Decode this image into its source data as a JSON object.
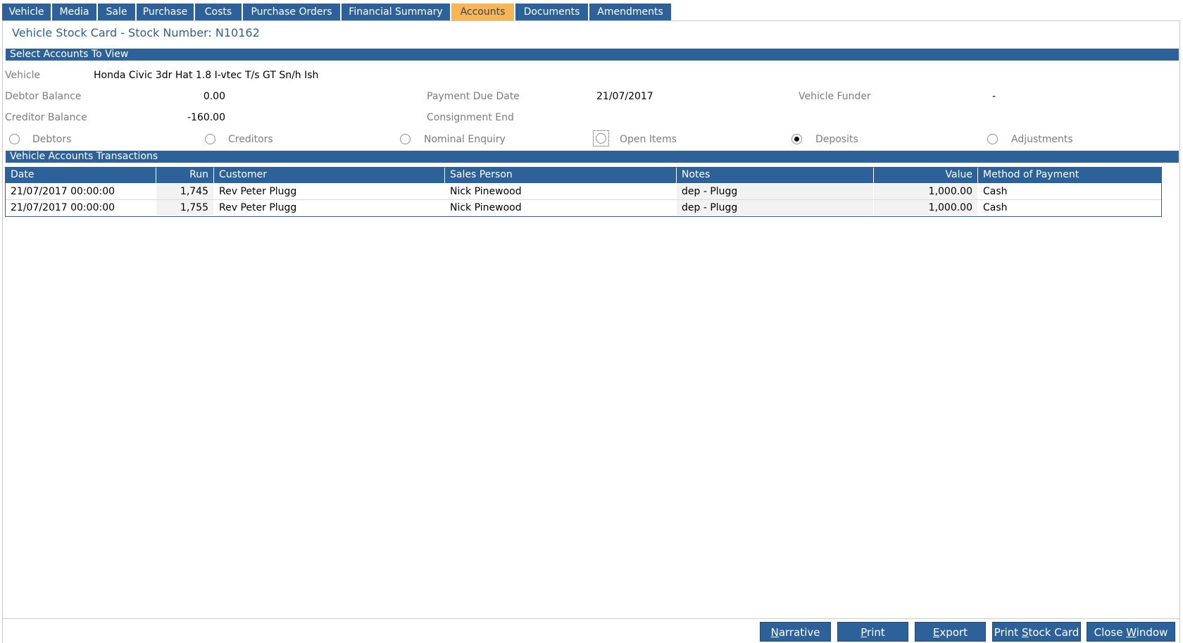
{
  "tabs": [
    {
      "label": "Vehicle"
    },
    {
      "label": "Media"
    },
    {
      "label": "Sale"
    },
    {
      "label": "Purchase"
    },
    {
      "label": "Costs"
    },
    {
      "label": "Purchase Orders"
    },
    {
      "label": "Financial Summary"
    },
    {
      "label": "Accounts"
    },
    {
      "label": "Documents"
    },
    {
      "label": "Amendments"
    }
  ],
  "active_tab": "Accounts",
  "page_title": "Vehicle Stock Card - Stock Number: N10162",
  "select_section_title": "Select Accounts To View",
  "vehicle": {
    "label": "Vehicle",
    "value": "Honda Civic 3dr Hat 1.8 I-vtec T/s GT Sn/h Ish"
  },
  "debtor_balance": {
    "label": "Debtor Balance",
    "value": "0.00"
  },
  "creditor_balance": {
    "label": "Creditor Balance",
    "value": "-160.00"
  },
  "payment_due_date": {
    "label": "Payment Due Date",
    "value": "21/07/2017"
  },
  "consignment_end": {
    "label": "Consignment End",
    "value": ""
  },
  "vehicle_funder": {
    "label": "Vehicle Funder",
    "value": "-"
  },
  "account_types": [
    {
      "label": "Debtors",
      "selected": false
    },
    {
      "label": "Creditors",
      "selected": false
    },
    {
      "label": "Nominal Enquiry",
      "selected": false
    },
    {
      "label": "Open Items",
      "selected": false
    },
    {
      "label": "Deposits",
      "selected": true
    },
    {
      "label": "Adjustments",
      "selected": false
    }
  ],
  "transactions_section_title": "Vehicle Accounts Transactions",
  "table": {
    "columns": [
      "Date",
      "Run",
      "Customer",
      "Sales Person",
      "Notes",
      "Value",
      "Method of Payment"
    ],
    "rows": [
      [
        "21/07/2017 00:00:00",
        "1,745",
        "Rev Peter Plugg",
        "Nick Pinewood",
        "dep - Plugg",
        "1,000.00",
        "Cash"
      ],
      [
        "21/07/2017 00:00:00",
        "1,755",
        "Rev Peter Plugg",
        "Nick Pinewood",
        "dep - Plugg",
        "1,000.00",
        "Cash"
      ]
    ]
  },
  "buttons": {
    "narrative": {
      "first": "N",
      "rest": "arrative"
    },
    "print": {
      "first": "P",
      "rest": "rint"
    },
    "export": {
      "first": "E",
      "rest": "xport"
    },
    "print_stock_card": {
      "before": "Print ",
      "key": "S",
      "after": "tock Card"
    },
    "close_window": {
      "before": "Close ",
      "key": "W",
      "after": "indow"
    }
  },
  "colors": {
    "primary": "#2d6199",
    "active_tab": "#f9b454",
    "label_gray": "#7c7c7c"
  }
}
